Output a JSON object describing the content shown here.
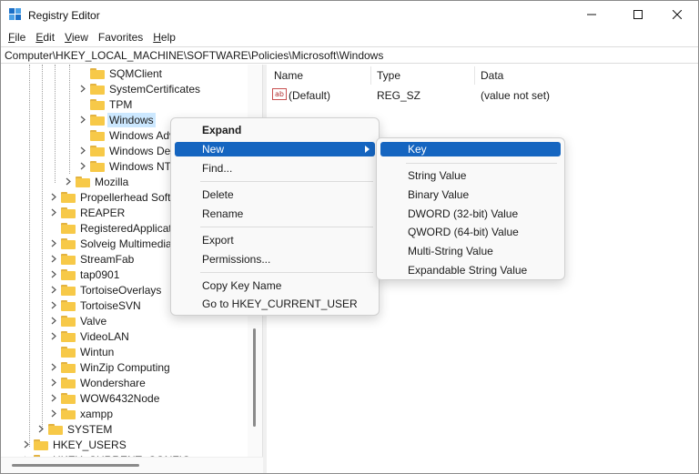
{
  "window": {
    "title": "Registry Editor"
  },
  "menubar": {
    "items": [
      {
        "label_u": "F",
        "label_rest": "ile"
      },
      {
        "label_u": "E",
        "label_rest": "dit"
      },
      {
        "label_u": "V",
        "label_rest": "iew"
      },
      {
        "label_u": "",
        "label_pre": "F",
        "label_rest": "avorites",
        "u_index": 0
      },
      {
        "label_u": "H",
        "label_rest": "elp"
      }
    ]
  },
  "address": "Computer\\HKEY_LOCAL_MACHINE\\SOFTWARE\\Policies\\Microsoft\\Windows",
  "tree": {
    "items": [
      {
        "label": "SQMClient",
        "chevron": false
      },
      {
        "label": "SystemCertificates",
        "chevron": true
      },
      {
        "label": "TPM",
        "chevron": false
      },
      {
        "label": "Windows",
        "chevron": true,
        "selected": true
      },
      {
        "label": "Windows Adv",
        "chevron": false
      },
      {
        "label": "Windows Defe",
        "chevron": true
      },
      {
        "label": "Windows NT",
        "chevron": true
      },
      {
        "label": "Mozilla",
        "chevron": true
      },
      {
        "label": "Propellerhead Softw",
        "chevron": true
      },
      {
        "label": "REAPER",
        "chevron": true
      },
      {
        "label": "RegisteredApplicatio",
        "chevron": false
      },
      {
        "label": "Solveig Multimedia",
        "chevron": true
      },
      {
        "label": "StreamFab",
        "chevron": true
      },
      {
        "label": "tap0901",
        "chevron": true
      },
      {
        "label": "TortoiseOverlays",
        "chevron": true
      },
      {
        "label": "TortoiseSVN",
        "chevron": true
      },
      {
        "label": "Valve",
        "chevron": true
      },
      {
        "label": "VideoLAN",
        "chevron": true
      },
      {
        "label": "Wintun",
        "chevron": false
      },
      {
        "label": "WinZip Computing",
        "chevron": true
      },
      {
        "label": "Wondershare",
        "chevron": true
      },
      {
        "label": "WOW6432Node",
        "chevron": true
      },
      {
        "label": "xampp",
        "chevron": true
      },
      {
        "label": "SYSTEM",
        "chevron": true
      },
      {
        "label": "HKEY_USERS",
        "chevron": true
      },
      {
        "label": "HKEY_CURRENT_CONFIG",
        "chevron": true
      }
    ]
  },
  "values_pane": {
    "columns": {
      "name": "Name",
      "type": "Type",
      "data": "Data"
    },
    "rows": [
      {
        "name": "(Default)",
        "type": "REG_SZ",
        "data": "(value not set)",
        "icon": "string-value-icon"
      }
    ]
  },
  "context_menu": {
    "expand": "Expand",
    "new": "New",
    "find": "Find...",
    "delete": "Delete",
    "rename": "Rename",
    "export": "Export",
    "permissions": "Permissions...",
    "copy_key_name": "Copy Key Name",
    "goto": "Go to HKEY_CURRENT_USER"
  },
  "submenu": {
    "key": "Key",
    "string_value": "String Value",
    "binary_value": "Binary Value",
    "dword_value": "DWORD (32-bit) Value",
    "qword_value": "QWORD (64-bit) Value",
    "multi_string_value": "Multi-String Value",
    "expandable_string_value": "Expandable String Value"
  },
  "colors": {
    "highlight": "#1565c0",
    "selection": "#cce8ff",
    "folder": "#f7c948"
  }
}
